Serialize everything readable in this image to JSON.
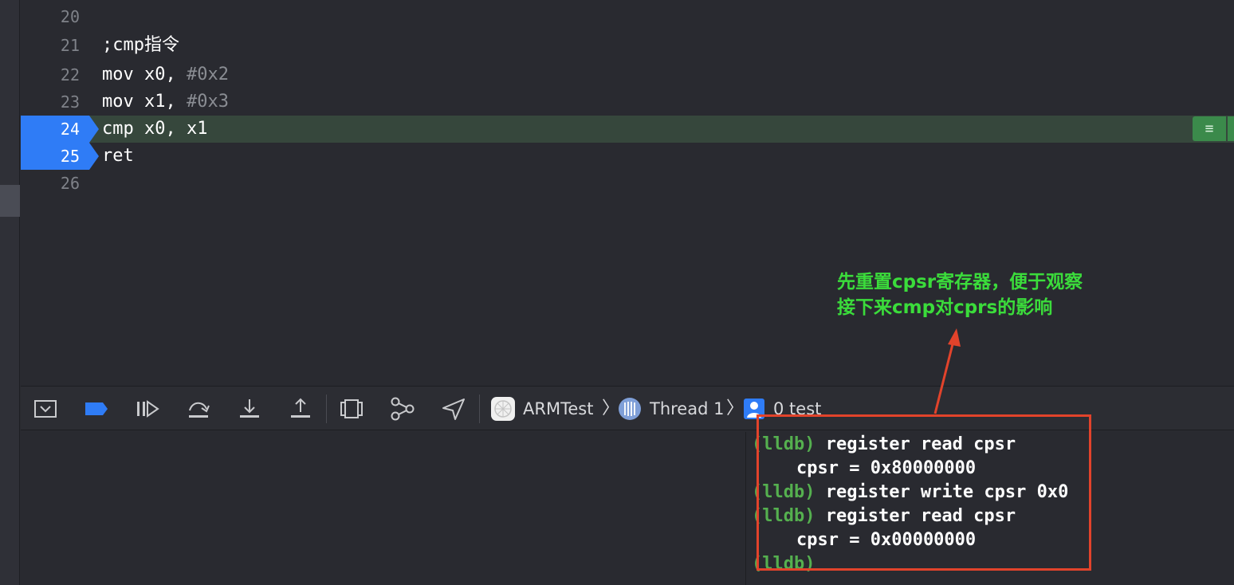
{
  "editor": {
    "lines": [
      {
        "num": "20",
        "text": ""
      },
      {
        "num": "21",
        "text": ";cmp指令"
      },
      {
        "num": "22",
        "code": "mov x0, ",
        "imm": "#0x2"
      },
      {
        "num": "23",
        "code": "mov x1, ",
        "imm": "#0x3"
      },
      {
        "num": "24",
        "text": "cmp x0, x1"
      },
      {
        "num": "25",
        "text": "ret"
      },
      {
        "num": "26",
        "text": ""
      }
    ],
    "annotation_button_icon": "list-icon"
  },
  "note": {
    "line1": "先重置cpsr寄存器，便于观察",
    "line2": "接下来cmp对cprs的影响",
    "color": "#3bdc3b"
  },
  "debug_bar": {
    "buttons": [
      "hide-console-icon",
      "breakpoints-toggle-icon",
      "continue-icon",
      "step-over-icon",
      "step-into-icon",
      "step-out-icon",
      "view-debugger-icon",
      "memory-graph-icon",
      "simulate-location-icon"
    ],
    "breadcrumb": {
      "app": "ARMTest",
      "thread": "Thread 1",
      "frame": "0 test"
    }
  },
  "console": {
    "lines": [
      {
        "prompt": "(lldb)",
        "cmd": " register read cpsr"
      },
      {
        "prompt": "",
        "cmd": "cpsr = 0x80000000"
      },
      {
        "prompt": "(lldb)",
        "cmd": " register write cpsr 0x0"
      },
      {
        "prompt": "(lldb)",
        "cmd": " register read cpsr"
      },
      {
        "prompt": "",
        "cmd": "cpsr = 0x00000000"
      },
      {
        "prompt": "(lldb)",
        "cmd": ""
      }
    ]
  },
  "colors": {
    "breakpoint": "#2f7cf6",
    "highlight_line": "#36473c",
    "annotation_box": "#e2432b",
    "prompt": "#55b04f"
  }
}
